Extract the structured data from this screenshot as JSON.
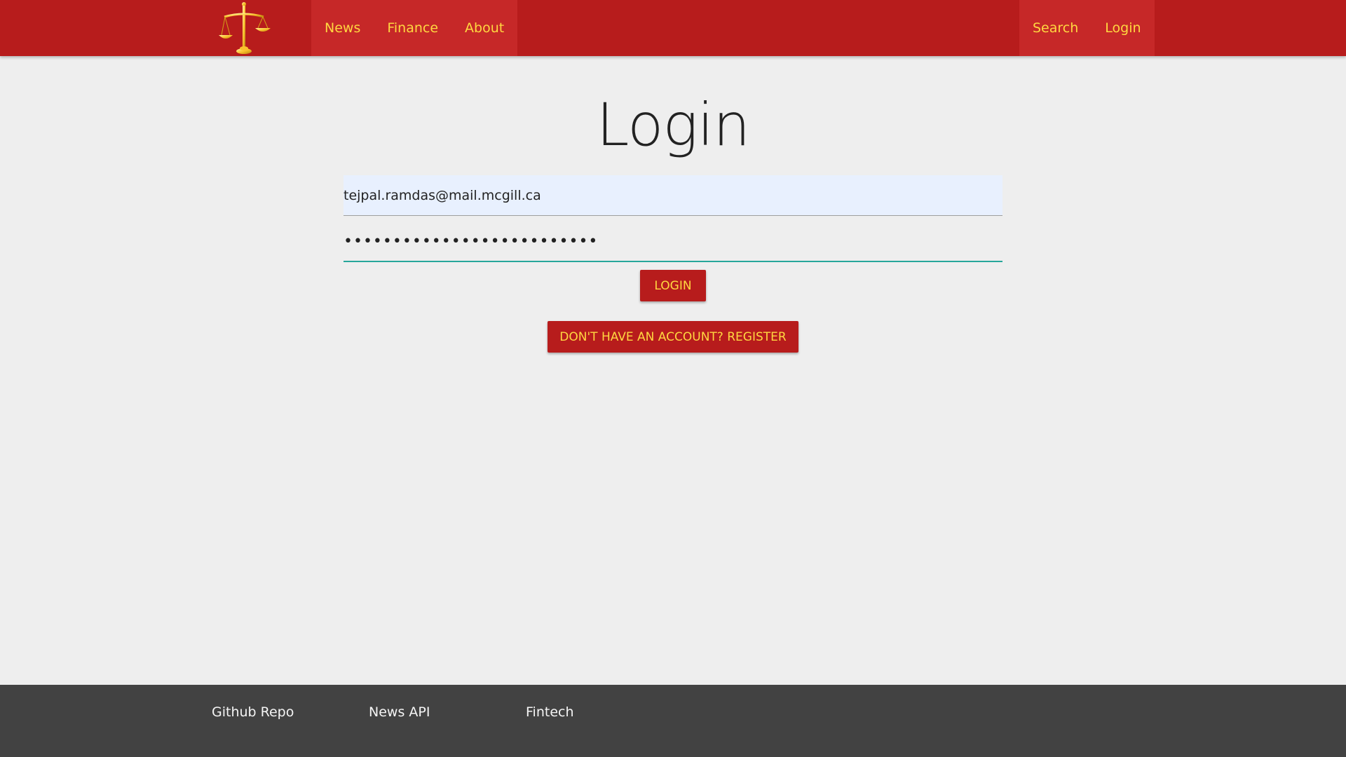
{
  "header": {
    "logo_icon": "scales-of-justice-icon",
    "nav_left": [
      {
        "label": "News"
      },
      {
        "label": "Finance"
      },
      {
        "label": "About"
      }
    ],
    "nav_right": [
      {
        "label": "Search"
      },
      {
        "label": "Login"
      }
    ]
  },
  "main": {
    "title": "Login",
    "email_value": "tejpal.ramdas@mail.mcgill.ca",
    "password_value": "••••••••••••••••••••••••••",
    "login_button": "LOGIN",
    "register_button": "DON'T HAVE AN ACCOUNT? REGISTER"
  },
  "footer": {
    "links": [
      {
        "label": "Github Repo"
      },
      {
        "label": "News API"
      },
      {
        "label": "Fintech"
      }
    ]
  },
  "colors": {
    "brand_red": "#b71c1c",
    "nav_highlight": "#c62828",
    "accent_gold": "#ffd740",
    "input_focus": "#26a69a",
    "footer_bg": "#424242",
    "page_bg": "#eeeeee"
  }
}
